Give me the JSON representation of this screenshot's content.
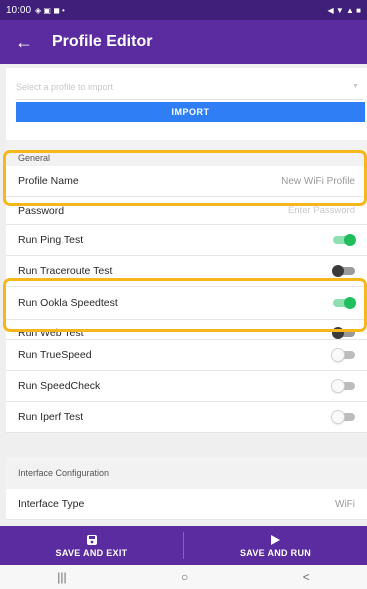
{
  "status_bar": {
    "time": "10:00",
    "right_icons": "◀ ▼ ▲ ■"
  },
  "app_bar": {
    "title": "Profile Editor",
    "back_icon": "back-arrow-icon"
  },
  "import": {
    "select_placeholder": "Select a profile to import",
    "button_label": "IMPORT"
  },
  "sections": {
    "general": "General",
    "interface": "Interface Configuration"
  },
  "general_rows": [
    {
      "label": "Profile Name",
      "value": "New WiFi Profile"
    },
    {
      "label": "Password",
      "placeholder": "Enter Password"
    },
    {
      "label": "Run Ping Test",
      "toggle": "on"
    },
    {
      "label": "Run Traceroute Test",
      "toggle": "off"
    },
    {
      "label": "Run Ookla Speedtest",
      "toggle": "on"
    },
    {
      "label": "Run Web Test",
      "toggle": "off"
    },
    {
      "label": "Run TrueSpeed",
      "toggle": "off"
    },
    {
      "label": "Run SpeedCheck",
      "toggle": "off"
    },
    {
      "label": "Run Iperf Test",
      "toggle": "off"
    }
  ],
  "interface_rows": [
    {
      "label": "Interface Type",
      "value": "WiFi"
    }
  ],
  "bottom_actions": {
    "save_exit": "SAVE AND EXIT",
    "save_run": "SAVE AND RUN"
  },
  "nav": {
    "recents": "|||",
    "home": "○",
    "back": "<"
  },
  "colors": {
    "primary": "#5b2c9f",
    "accent_button": "#2f7ef5",
    "toggle_on": "#1fbf5e",
    "highlight": "#f6b71a"
  }
}
